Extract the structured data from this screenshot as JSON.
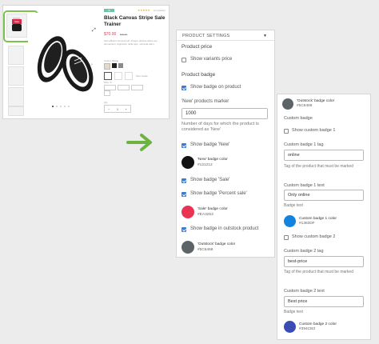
{
  "product": {
    "badge_top": "IN STOCK",
    "badge_sale": "Sale",
    "title_line1": "Black Canvas Stripe Sale",
    "title_line2": "Trainer",
    "price": "$70.00",
    "old_price": "$79.00",
    "rating_text": "(2 reviews)",
    "stars": "★★★★★",
    "description": "Sed efficitur rhoncus elit. Integer ultrices tellus nec elementum, dignissim nulla quis, vehicula diam.",
    "color_label": "Colour: Beige",
    "size_label": "Size: S",
    "size_guide": "Size Guide",
    "qty_minus": "−",
    "qty_value": "1",
    "qty_plus": "+",
    "qty_label": "Qty"
  },
  "arrow_color": "#6cb33f",
  "panel1": {
    "header": "PRODUCT SETTINGS",
    "section_price": "Product price",
    "show_variants_price": "Show variants price",
    "section_badge": "Product badge",
    "show_badge_on_product": "Show badge on product",
    "new_marker_label": "'New' products marker",
    "new_marker_value": "1000",
    "new_marker_help": "Number of days for which the product is considered as 'New'",
    "show_badge_new": "Show badge 'New'",
    "new_color_title": "'New' badge color",
    "new_color_hex": "#121212",
    "new_color": "#121212",
    "show_badge_sale": "Show badge 'Sale'",
    "show_badge_percent": "Show badge 'Percent sale'",
    "sale_color_title": "'Sale' badge color",
    "sale_color_hex": "#EA3253",
    "sale_color": "#EA3253",
    "show_badge_outstock": "Show badge in outstock product",
    "outstock_color_title": "'Outstock' badge color",
    "outstock_color_hex": "#5C6468",
    "outstock_color": "#5C6468"
  },
  "panel2": {
    "outstock_color_title": "'Outstock' badge color",
    "outstock_color_hex": "#5C6468",
    "outstock_color": "#5C6468",
    "custom_badge": "Custom badge",
    "show_custom_1": "Show custom badge 1",
    "custom1_tag_label": "Custom badge 1 tag",
    "custom1_tag_value": "online",
    "custom1_tag_help": "Tag of the product that must be marked",
    "custom1_text_label": "Custom badge 1 text",
    "custom1_text_value": "Only online",
    "custom1_text_help": "Badge text",
    "custom1_color_title": "Custom badge 1 color",
    "custom1_color_hex": "#1383DF",
    "custom1_color": "#1383DF",
    "show_custom_2": "Show custom badge 2",
    "custom2_tag_label": "Custom badge 2 tag",
    "custom2_tag_value": "best-price",
    "custom2_tag_help": "Tag of the product that must be marked",
    "custom2_text_label": "Custom badge 2 text",
    "custom2_text_value": "Best price",
    "custom2_text_help": "Badge text",
    "custom2_color_title": "Custom badge 2 color",
    "custom2_color_hex": "#394CB3",
    "custom2_color": "#394CB3"
  }
}
